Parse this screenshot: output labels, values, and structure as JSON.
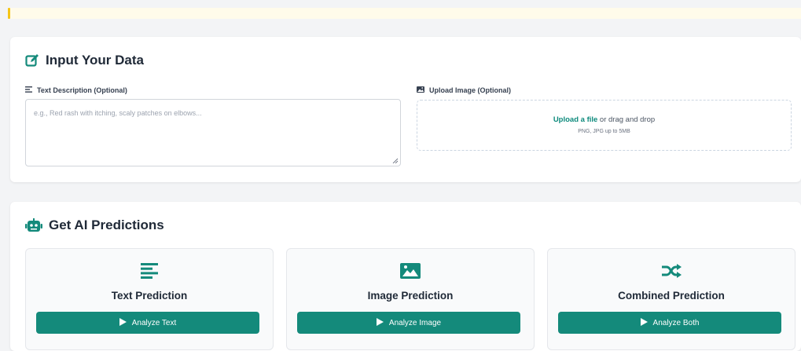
{
  "input_section": {
    "title": "Input Your Data",
    "text_label": "Text Description (Optional)",
    "text_placeholder": "e.g., Red rash with itching, scaly patches on elbows...",
    "image_label": "Upload Image (Optional)",
    "upload_link": "Upload a file",
    "upload_rest": " or drag and drop",
    "upload_hint": "PNG, JPG up to 5MB"
  },
  "predictions_section": {
    "title": "Get AI Predictions",
    "cards": [
      {
        "title": "Text Prediction",
        "button": "Analyze Text",
        "icon": "text-lines-icon"
      },
      {
        "title": "Image Prediction",
        "button": "Analyze Image",
        "icon": "image-icon"
      },
      {
        "title": "Combined Prediction",
        "button": "Analyze Both",
        "icon": "shuffle-icon"
      }
    ]
  },
  "colors": {
    "accent": "#148a7b",
    "link": "#0d8a7c",
    "notice_background": "#fffbea",
    "notice_bar": "#f5c518"
  }
}
